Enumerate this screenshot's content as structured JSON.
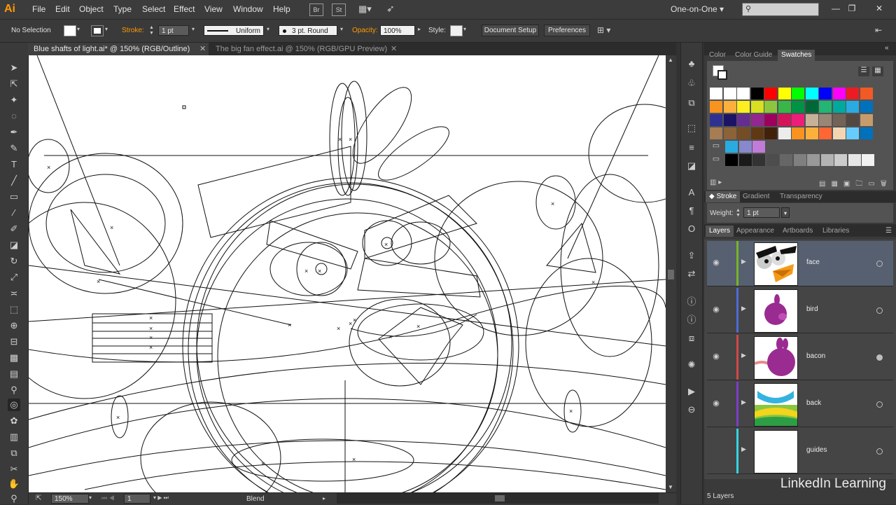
{
  "app": {
    "logo": "Ai"
  },
  "menu": [
    "File",
    "Edit",
    "Object",
    "Type",
    "Select",
    "Effect",
    "View",
    "Window",
    "Help"
  ],
  "bridge_buttons": [
    "Br",
    "St"
  ],
  "workspace": "One-on-One",
  "control": {
    "selection": "No Selection",
    "stroke_label": "Stroke:",
    "stroke_value": "1 pt",
    "stroke_profile": "Uniform",
    "brush": "3 pt. Round",
    "opacity_label": "Opacity:",
    "opacity_value": "100%",
    "style_label": "Style:",
    "document_setup": "Document Setup",
    "preferences": "Preferences"
  },
  "tabs": [
    {
      "label": "Blue shafts of light.ai* @ 150% (RGB/Outline)",
      "active": true
    },
    {
      "label": "The big fan effect.ai @ 150% (RGB/GPU Preview)",
      "active": false
    }
  ],
  "status": {
    "zoom": "150%",
    "artboard": "1",
    "tool_status": "Blend"
  },
  "swatch_panel": {
    "tabs": [
      "Color",
      "Color Guide",
      "Swatches"
    ],
    "active_tab": "Swatches",
    "rows": [
      [
        "#ffffff",
        "#ffffff",
        "#ffffff",
        "#000000",
        "#ff0000",
        "#ffff00",
        "#00ff00",
        "#00ffff",
        "#0000ff",
        "#ff00ff",
        "#ed1c24",
        "#f15a24"
      ],
      [
        "#f7931e",
        "#fbb03b",
        "#fcee21",
        "#d9e021",
        "#8cc63f",
        "#39b54a",
        "#009245",
        "#006837",
        "#22b573",
        "#00a99d",
        "#29abe2",
        "#0071bc"
      ],
      [
        "#2e3192",
        "#1b1464",
        "#662d91",
        "#93278f",
        "#9e005d",
        "#d4145a",
        "#ed1e79",
        "#c7b299",
        "#998675",
        "#736357",
        "#534741",
        "#c69c6d"
      ],
      [
        "#a67c52",
        "#8c6239",
        "#754c24",
        "#603813",
        "#42210b",
        "#ececec",
        "#f7931e",
        "#fbb03b",
        "#ff6633",
        "#f2d6b3",
        "#66ccff",
        "#0071bc"
      ],
      [
        "#29abe2",
        "#8888cc",
        "#c07cd8"
      ],
      [
        "#000000",
        "#1a1a1a",
        "#333333",
        "#4d4d4d",
        "#666666",
        "#808080",
        "#999999",
        "#b3b3b3",
        "#cccccc",
        "#e6e6e6",
        "#f2f2f2"
      ]
    ]
  },
  "stroke_panel": {
    "tabs": [
      "Stroke",
      "Gradient",
      "Transparency"
    ],
    "weight_label": "Weight:",
    "weight_value": "1 pt"
  },
  "layers_panel": {
    "tabs": [
      "Layers",
      "Appearance",
      "Artboards",
      "Libraries"
    ],
    "layers": [
      {
        "name": "face",
        "color": "#78b429",
        "selected": true
      },
      {
        "name": "bird",
        "color": "#4e6bd8",
        "selected": false
      },
      {
        "name": "bacon",
        "color": "#d14848",
        "selected": false
      },
      {
        "name": "back",
        "color": "#7b3fc7",
        "selected": false
      },
      {
        "name": "guides",
        "color": "#37d3e3",
        "selected": false
      }
    ],
    "count": "5 Layers"
  },
  "watermark": "LinkedIn Learning"
}
